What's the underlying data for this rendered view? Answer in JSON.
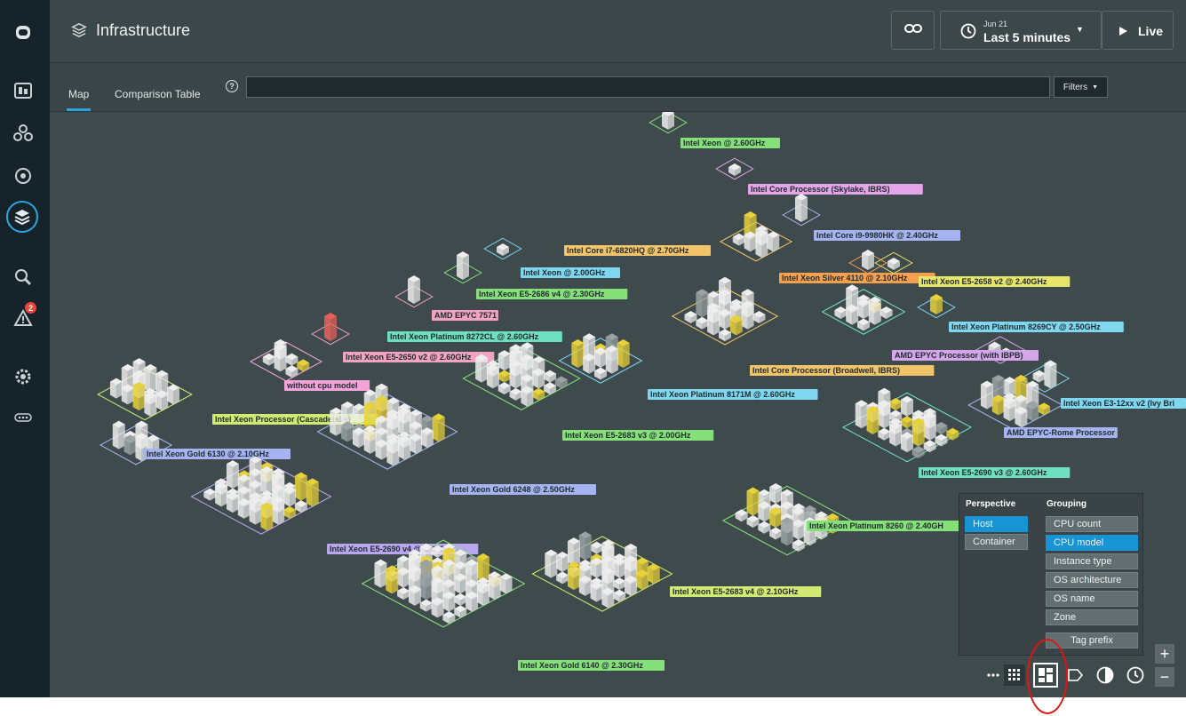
{
  "header": {
    "title": "Infrastructure",
    "date_small": "Jun 21",
    "time_range": "Last 5 minutes",
    "live_label": "Live"
  },
  "tabs": [
    {
      "label": "Map",
      "active": true
    },
    {
      "label": "Comparison Table",
      "active": false
    }
  ],
  "search": {
    "placeholder": "",
    "filters_label": "Filters"
  },
  "sidebar": {
    "items": [
      {
        "icon": "robot-logo-icon"
      },
      {
        "icon": "dashboard-icon"
      },
      {
        "icon": "services-icon"
      },
      {
        "icon": "platform-icon"
      },
      {
        "icon": "infrastructure-icon",
        "active": true
      },
      {
        "icon": "analyze-icon"
      },
      {
        "icon": "events-warning-icon",
        "badge": "2"
      },
      {
        "icon": "settings-icon"
      },
      {
        "icon": "more-icon"
      }
    ]
  },
  "map": {
    "groups": [
      {
        "label": "Intel Xeon @ 2.60GHz",
        "color": "#86e07a"
      },
      {
        "label": "Intel Core Processor (Skylake, IBRS)",
        "color": "#e4a6e8"
      },
      {
        "label": "Intel Core i9-9980HK @ 2.40GHz",
        "color": "#a5b4f0"
      },
      {
        "label": "Intel Core i7-6820HQ @ 2.70GHz",
        "color": "#f2c46a"
      },
      {
        "label": "Intel Xeon Silver 4110 @ 2.10GHz",
        "color": "#f4a04e"
      },
      {
        "label": "Intel Xeon E5-2658 v2 @ 2.40GHz",
        "color": "#e8e66a"
      },
      {
        "label": "Intel Xeon @ 2.00GHz",
        "color": "#7fd6ef"
      },
      {
        "label": "Intel Xeon E5-2686 v4 @ 2.30GHz",
        "color": "#86e07a"
      },
      {
        "label": "AMD EPYC 7571",
        "color": "#f2a3c2"
      },
      {
        "label": "Intel Xeon Platinum 8269CY @ 2.50GHz",
        "color": "#7fd6ef"
      },
      {
        "label": "Intel Xeon Platinum 8272CL @ 2.60GHz",
        "color": "#6ee0c0"
      },
      {
        "label": "AMD EPYC Processor (with IBPB)",
        "color": "#d5a6ec"
      },
      {
        "label": "Intel Xeon E5-2650 v2 @ 2.60GHz",
        "color": "#f2a3c2"
      },
      {
        "label": "Intel Core Processor (Broadwell, IBRS)",
        "color": "#f2c46a"
      },
      {
        "label": "without cpu model",
        "color": "#f2a3d8"
      },
      {
        "label": "Intel Xeon Platinum 8171M @ 2.60GHz",
        "color": "#7fd6ef"
      },
      {
        "label": "Intel Xeon E3-12xx v2 (Ivy Bri",
        "color": "#7fd6ef"
      },
      {
        "label": "Intel Xeon Processor (Cascadelake)",
        "color": "#d2ea72"
      },
      {
        "label": "Intel Xeon E5-2683 v3 @ 2.00GHz",
        "color": "#86e07a"
      },
      {
        "label": "AMD EPYC-Rome Processor",
        "color": "#a5b4f0"
      },
      {
        "label": "Intel Xeon Gold 6130 @ 2.10GHz",
        "color": "#a5b4f0"
      },
      {
        "label": "Intel Xeon E5-2690 v3 @ 2.60GHz",
        "color": "#6ee0c0"
      },
      {
        "label": "Intel Xeon Gold 6248 @ 2.50GHz",
        "color": "#a5b4f0"
      },
      {
        "label": "Intel Xeon Platinum 8260 @ 2.40GH",
        "color": "#86e07a"
      },
      {
        "label": "Intel Xeon E5-2690 v4 @ 2.60GHz",
        "color": "#b8a6ef"
      },
      {
        "label": "Intel Xeon E5-2683 v4 @ 2.10GHz",
        "color": "#d2ea72"
      },
      {
        "label": "Intel Xeon Gold 6140 @ 2.30GHz",
        "color": "#86e07a"
      }
    ]
  },
  "panel": {
    "perspective_title": "Perspective",
    "grouping_title": "Grouping",
    "perspective": [
      {
        "label": "Host",
        "selected": true
      },
      {
        "label": "Container",
        "selected": false
      }
    ],
    "grouping": [
      {
        "label": "CPU count",
        "selected": false
      },
      {
        "label": "CPU model",
        "selected": true
      },
      {
        "label": "Instance type",
        "selected": false
      },
      {
        "label": "OS architecture",
        "selected": false
      },
      {
        "label": "OS name",
        "selected": false
      },
      {
        "label": "Zone",
        "selected": false
      }
    ],
    "tag_prefix_label": "Tag prefix"
  },
  "toolbar": {
    "buttons": [
      "more-icon",
      "grid-view-icon",
      "treemap-view-icon",
      "tag-icon",
      "contrast-icon",
      "clock-icon"
    ],
    "zoom_in": "+",
    "zoom_out": "−"
  },
  "colors": {
    "background": "#3e4a4b",
    "sidebar": "#17232a",
    "accent": "#2aa6df",
    "selected": "#1794d4",
    "host_box": "#eeeeee",
    "host_warn": "#e8d23a",
    "host_critical": "#e8615a",
    "annotation": "#e01414"
  }
}
